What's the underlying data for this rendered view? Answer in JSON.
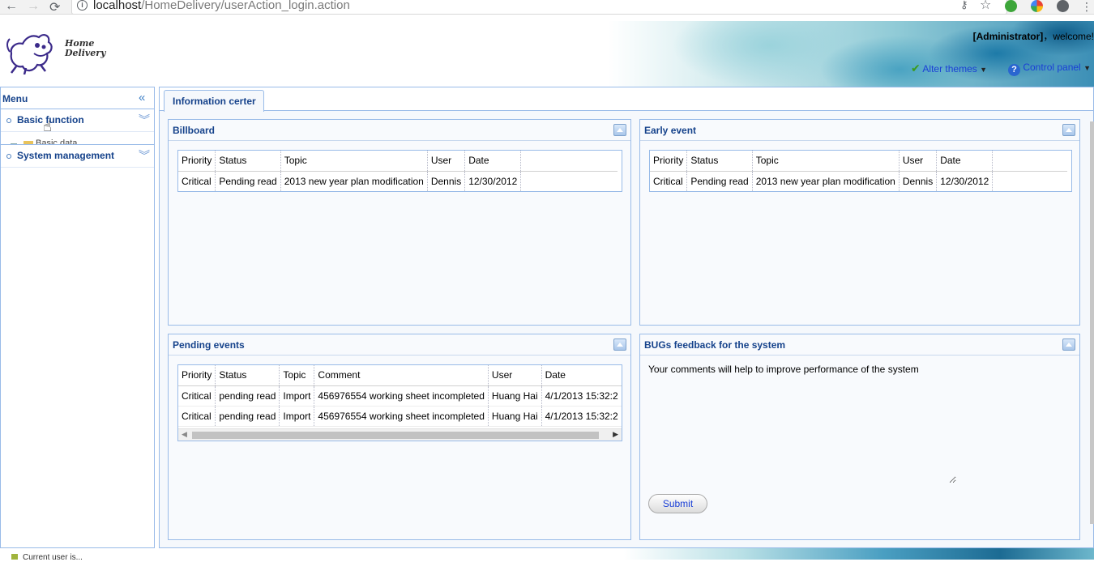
{
  "browser": {
    "url_host": "localhost",
    "url_path": "/HomeDelivery/userAction_login.action"
  },
  "header": {
    "logo_line1": "Home",
    "logo_line2": "Delivery",
    "user_role": "[Administrator]",
    "welcome": "，welcome!",
    "alter_themes": "Alter themes",
    "control_panel": "Control panel"
  },
  "sidebar": {
    "title": "Menu",
    "items": [
      {
        "label": "Basic function"
      },
      {
        "label": "System management"
      }
    ],
    "sub_item": "Basic data"
  },
  "main": {
    "tab_label": "Information certer"
  },
  "billboard": {
    "title": "Billboard",
    "columns": [
      "Priority",
      "Status",
      "Topic",
      "User",
      "Date"
    ],
    "rows": [
      [
        "Critical",
        "Pending read",
        "2013 new year plan modification",
        "Dennis",
        "12/30/2012"
      ]
    ]
  },
  "early_event": {
    "title": "Early event",
    "columns": [
      "Priority",
      "Status",
      "Topic",
      "User",
      "Date"
    ],
    "rows": [
      [
        "Critical",
        "Pending read",
        "2013 new year plan modification",
        "Dennis",
        "12/30/2012"
      ]
    ]
  },
  "pending_events": {
    "title": "Pending events",
    "columns": [
      "Priority",
      "Status",
      "Topic",
      "Comment",
      "User",
      "Date"
    ],
    "rows": [
      [
        "Critical",
        "pending read",
        "Import",
        "456976554 working sheet incompleted",
        "Huang Hai",
        "4/1/2013 15:32:2"
      ],
      [
        "Critical",
        "pending read",
        "Import",
        "456976554 working sheet incompleted",
        "Huang Hai",
        "4/1/2013 15:32:2"
      ]
    ]
  },
  "bugs": {
    "title": "BUGs feedback for the system",
    "text": "Your comments will help to improve performance of the system",
    "submit_label": "Submit"
  },
  "footer": {
    "text": "Current user is..."
  }
}
